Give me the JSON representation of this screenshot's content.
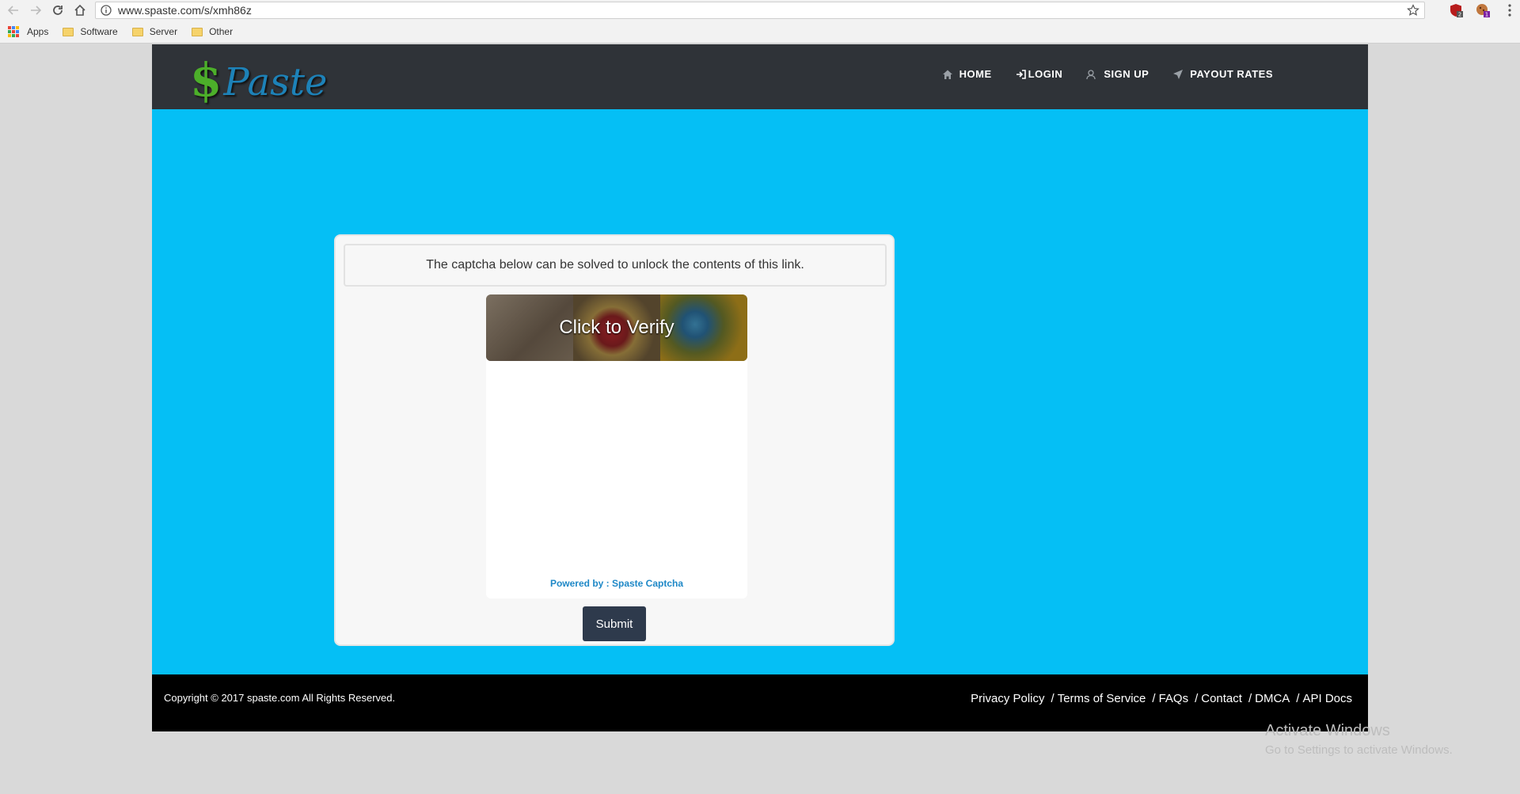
{
  "browser": {
    "url": "www.spaste.com/s/xmh86z",
    "bookmarks": [
      "Apps",
      "Software",
      "Server",
      "Other"
    ],
    "extensions": [
      {
        "icon": "ublock-icon",
        "badge": "2",
        "color": "#b71c1c"
      },
      {
        "icon": "cookie-extension-icon",
        "badge": "1",
        "color": "#8d3b2a"
      }
    ]
  },
  "site": {
    "logo": {
      "symbol": "$",
      "word": "Paste"
    },
    "nav": [
      {
        "label": "HOME",
        "icon": "home-icon"
      },
      {
        "label": "LOGIN",
        "icon": "login-icon"
      },
      {
        "label": "SIGN UP",
        "icon": "user-add-icon"
      },
      {
        "label": "PAYOUT RATES",
        "icon": "send-icon"
      }
    ],
    "notice": "The captcha below can be solved to unlock the contents of this link.",
    "captcha": {
      "button_label": "Click to Verify",
      "powered_by": "Powered by : Spaste Captcha"
    },
    "submit_label": "Submit",
    "footer": {
      "copyright": "Copyright © 2017 spaste.com All Rights Reserved.",
      "links": [
        "Privacy Policy",
        "Terms of Service",
        "FAQs",
        "Contact",
        "DMCA",
        "API Docs"
      ]
    }
  },
  "os_watermark": {
    "line1": "Activate Windows",
    "line2": "Go to Settings to activate Windows."
  },
  "colors": {
    "header_bg": "#2f3338",
    "hero_bg": "#05bff5",
    "footer_bg": "#000000",
    "submit_bg": "#2e3a4c",
    "logo_green": "#4caf2a",
    "logo_blue": "#1d82b8",
    "powered_link": "#1e88c7"
  }
}
